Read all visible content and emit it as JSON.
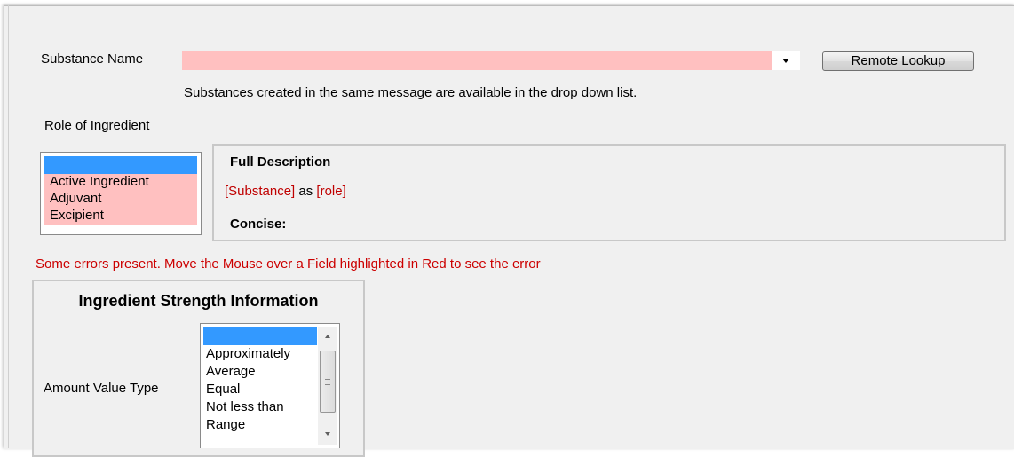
{
  "substance": {
    "label": "Substance Name",
    "value": "",
    "hint": "Substances created in the same message are available in the drop down list.",
    "lookup_button": "Remote Lookup"
  },
  "role": {
    "label": "Role of Ingredient",
    "options": [
      "",
      "Active Ingredient",
      "Adjuvant",
      "Excipient"
    ],
    "selected_index": 0
  },
  "description": {
    "title": "Full Description",
    "substance_token": "[Substance]",
    "connector": "as",
    "role_token": "[role]",
    "concise_label": "Concise:"
  },
  "error_message": "Some errors present. Move the Mouse over a Field highlighted in Red to see the error",
  "strength": {
    "title": "Ingredient Strength Information",
    "amount_label": "Amount Value Type",
    "amount_options": [
      "",
      "Approximately",
      "Average",
      "Equal",
      "Not less than",
      "Range"
    ],
    "selected_index": 0
  },
  "colors": {
    "error_field": "#ffc0c0",
    "selection": "#3399ff",
    "error_text": "#cc0000"
  },
  "icons": {
    "dropdown": "chevron-down-icon",
    "scroll_up": "scroll-up-icon",
    "scroll_down": "scroll-down-icon"
  }
}
